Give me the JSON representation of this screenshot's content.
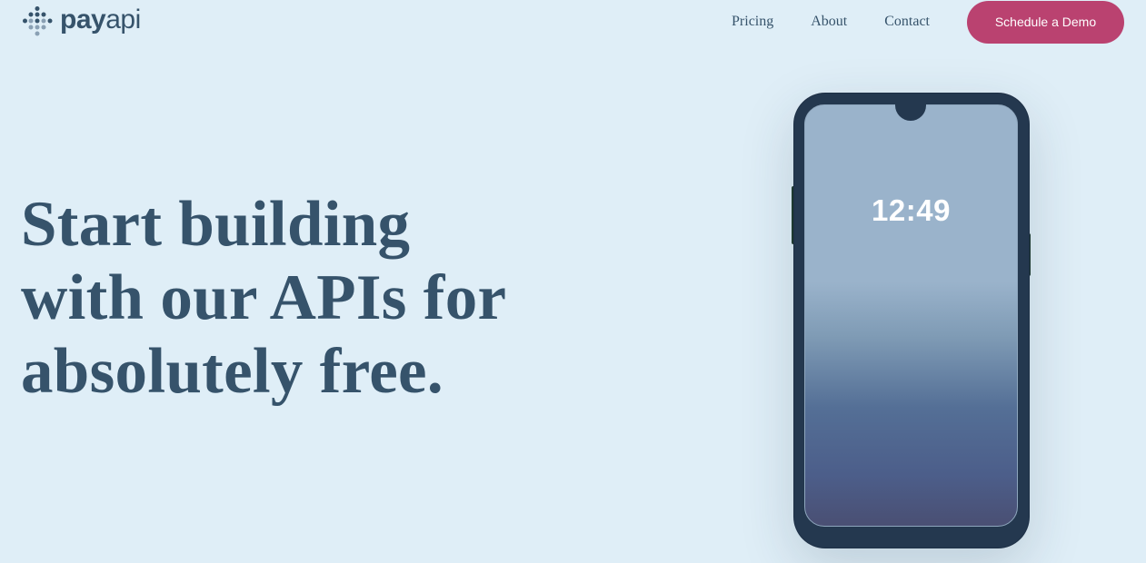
{
  "header": {
    "logo": {
      "text_bold": "pay",
      "text_light": "api",
      "icon": "payapi-dots-logo"
    },
    "nav": [
      {
        "label": "Pricing"
      },
      {
        "label": "About"
      },
      {
        "label": "Contact"
      }
    ],
    "cta_label": "Schedule a Demo"
  },
  "hero": {
    "title_line_1": "Start building",
    "title_line_2": "with our APIs for",
    "title_line_3": "absolutely free."
  },
  "phone": {
    "clock": "12:49"
  },
  "colors": {
    "background": "#dfeef7",
    "text_primary": "#36536b",
    "accent": "#ba4270",
    "phone_body": "#24384f"
  }
}
